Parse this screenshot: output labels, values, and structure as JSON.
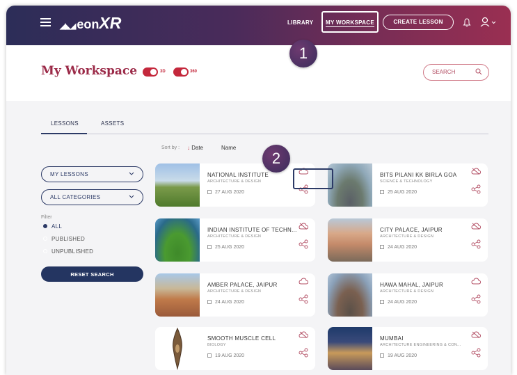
{
  "app": {
    "logo_eon": "eon",
    "logo_xr": "XR"
  },
  "nav": {
    "library": "LIBRARY",
    "my_workspace": "MY WORKSPACE",
    "create_lesson": "CREATE LESSON"
  },
  "badges": {
    "one": "1",
    "two": "2"
  },
  "header": {
    "title": "My Workspace",
    "toggle_3d": "3D",
    "toggle_360": "360",
    "search_placeholder": "SEARCH"
  },
  "tabs": {
    "lessons": "LESSONS",
    "assets": "ASSETS"
  },
  "sort": {
    "label": "Sort by :",
    "date": "Date",
    "name": "Name"
  },
  "sidebar": {
    "lessons_select": "MY LESSONS",
    "categories_select": "ALL CATEGORIES",
    "filter_label": "Filter",
    "filters": [
      {
        "label": "ALL",
        "selected": true
      },
      {
        "label": "PUBLISHED",
        "selected": false
      },
      {
        "label": "UNPUBLISHED",
        "selected": false
      }
    ],
    "reset": "RESET SEARCH"
  },
  "cards": [
    {
      "title": "NATIONAL INSTITUTE",
      "category": "ARCHITECTURE & DESIGN",
      "date": "27 AUG 2020",
      "cloud": "outline"
    },
    {
      "title": "BITS PILANI KK BIRLA GOA",
      "category": "SCIENCE & TECHNOLOGY",
      "date": "25 AUG 2020",
      "cloud": "crossed"
    },
    {
      "title": "INDIAN INSTITUTE OF TECHN...",
      "category": "ARCHITECTURE & DESIGN",
      "date": "25 AUG 2020",
      "cloud": "crossed"
    },
    {
      "title": "CITY PALACE, JAIPUR",
      "category": "ARCHITECTURE & DESIGN",
      "date": "24 AUG 2020",
      "cloud": "crossed"
    },
    {
      "title": "AMBER PALACE, JAIPUR",
      "category": "ARCHITECTURE & DESIGN",
      "date": "24 AUG 2020",
      "cloud": "outline"
    },
    {
      "title": "HAWA MAHAL, JAIPUR",
      "category": "ARCHITECTURE & DESIGN",
      "date": "24 AUG 2020",
      "cloud": "outline"
    },
    {
      "title": "SMOOTH MUSCLE CELL",
      "category": "BIOLOGY",
      "date": "19 AUG 2020",
      "cloud": "crossed"
    },
    {
      "title": "MUMBAI",
      "category": "ARCHITECTURE ENGINEERING & CON...",
      "date": "19 AUG 2020",
      "cloud": "crossed"
    }
  ],
  "colors": {
    "brand": "#9b2a48",
    "navy": "#2c3a66",
    "accent": "#c4283c"
  }
}
